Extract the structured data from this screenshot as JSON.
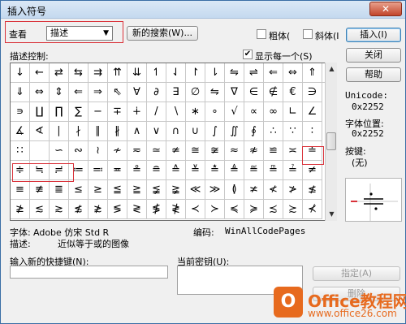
{
  "window": {
    "title": "插入符号",
    "close_label": "✕"
  },
  "toolbar": {
    "view_label": "查看",
    "view_value": "描述",
    "new_search_label": "新的搜索(W)...",
    "bold_label": "粗体(",
    "italic_label": "斜体(I",
    "insert_label": "插入(I)",
    "close_label": "关闭",
    "help_label": "帮助"
  },
  "descriptor": {
    "label": "描述控制:",
    "show_each_once_label": "显示每一个(S)",
    "show_each_once_checked": true
  },
  "symbols": [
    [
      "↓",
      "←",
      "⇄",
      "⇆",
      "⇉",
      "⇈",
      "⇊",
      "↿",
      "⇃",
      "↾",
      "⇂",
      "⇋",
      "⇌",
      "⇐",
      "⇔",
      "⇑",
      "⇒"
    ],
    [
      "⇓",
      "⇔",
      "⇕",
      "⇐",
      "⇒",
      "⇖",
      "∀",
      "∂",
      "∃",
      "∅",
      "⇋",
      "∇",
      "∈",
      "∉",
      "€",
      "∋"
    ],
    [
      "∍",
      "∐",
      "∏",
      "∑",
      "−",
      "∓",
      "∔",
      "/",
      "∖",
      "∗",
      "∘",
      "√",
      "∝",
      "∞",
      "∟",
      "∠"
    ],
    [
      "∡",
      "∢",
      "∣",
      "∤",
      "∥",
      "∦",
      "∧",
      "∨",
      "∩",
      "∪",
      "∫",
      "∬",
      "∮",
      "∴",
      "∵",
      "∶"
    ],
    [
      "∷",
      "",
      "∽",
      "∾",
      "≀",
      "≁",
      "≂",
      "≃",
      "≄",
      "≅",
      "≆",
      "≈",
      "≉",
      "≌",
      "≍",
      "≐"
    ],
    [
      "≑",
      "≒",
      "≓",
      "≔",
      "≕",
      "≖",
      "≗",
      "≘",
      "≙",
      "≚",
      "≛",
      "≜",
      "≝",
      "≞",
      "≟",
      "≠"
    ],
    [
      "≡",
      "≢",
      "≣",
      "≤",
      "≥",
      "≦",
      "≧",
      "≨",
      "≩",
      "≪",
      "≫",
      "≬",
      "≭",
      "≮",
      "≯",
      "≰"
    ],
    [
      "≱",
      "≲",
      "≳",
      "≴",
      "≵",
      "≶",
      "≷",
      "≸",
      "≹",
      "≺",
      "≻",
      "≼",
      "≽",
      "≾",
      "≿",
      "⊀"
    ]
  ],
  "info": {
    "unicode_label": "Unicode:",
    "unicode_value": "0x2252",
    "font_pos_label": "字体位置:",
    "font_pos_value": "0x2252",
    "key_label": "按键:",
    "key_value": "(无)"
  },
  "details": {
    "font_label": "字体:",
    "font_value": "Adobe 仿宋 Std R",
    "encoding_label": "编码:",
    "encoding_value": "WinAllCodePages",
    "desc_label": "描述:",
    "desc_value": "近似等于或的图像"
  },
  "shortcut": {
    "new_shortcut_label": "输入新的快捷键(N):",
    "current_key_label": "当前密钥(U):",
    "assign_label": "指定(A)",
    "remove_label": "删除"
  },
  "watermark": {
    "logo_letter": "O",
    "brand": "Office教程网",
    "url": "www.office26.com"
  }
}
